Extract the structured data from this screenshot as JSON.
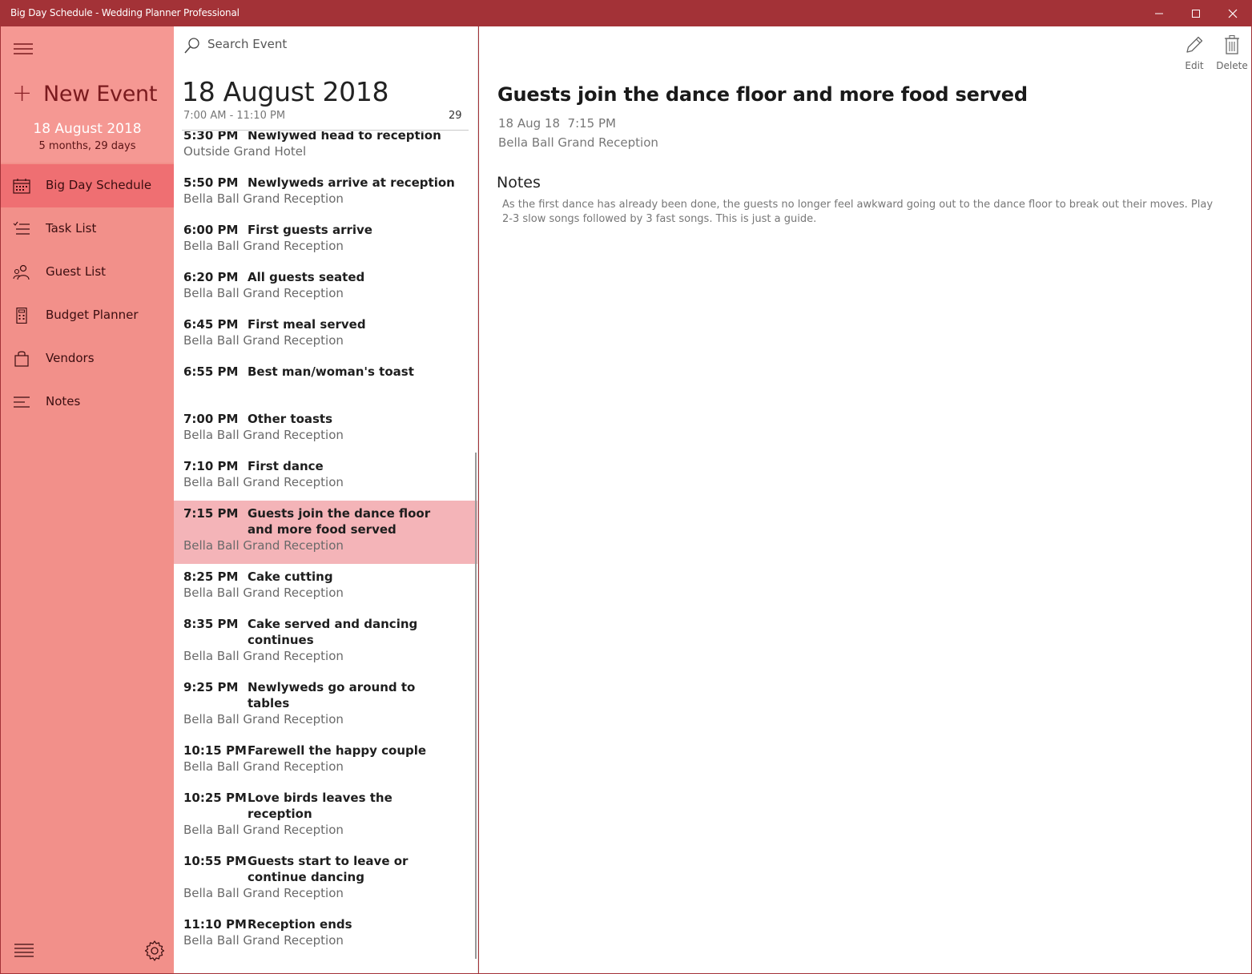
{
  "window": {
    "title": "Big Day Schedule - Wedding Planner Professional",
    "min_glyph": "—",
    "close_glyph": "✕"
  },
  "sidebar": {
    "new_event_label": "New Event",
    "plus_glyph": "+",
    "wedding_date": "18 August 2018",
    "countdown": "5 months, 29 days",
    "items": [
      {
        "label": "Big Day Schedule",
        "icon": "calendar-icon",
        "active": true
      },
      {
        "label": "Task List",
        "icon": "checklist-icon",
        "active": false
      },
      {
        "label": "Guest List",
        "icon": "people-icon",
        "active": false
      },
      {
        "label": "Budget Planner",
        "icon": "calculator-icon",
        "active": false
      },
      {
        "label": "Vendors",
        "icon": "shopping-bag-icon",
        "active": false
      },
      {
        "label": "Notes",
        "icon": "notes-icon",
        "active": false
      }
    ]
  },
  "list": {
    "search_placeholder": "Search Event",
    "date": "18 August 2018",
    "time_range": "7:00 AM - 11:10 PM",
    "event_count": "29",
    "events": [
      {
        "time": "5:30 PM",
        "name": "Newlywed head to reception",
        "location": "Outside Grand Hotel",
        "selected": false
      },
      {
        "time": "5:50 PM",
        "name": "Newlyweds arrive at reception",
        "location": "Bella Ball Grand Reception",
        "selected": false
      },
      {
        "time": "6:00 PM",
        "name": "First guests arrive",
        "location": "Bella Ball Grand Reception",
        "selected": false
      },
      {
        "time": "6:20 PM",
        "name": "All guests seated",
        "location": "Bella Ball Grand Reception",
        "selected": false
      },
      {
        "time": "6:45 PM",
        "name": "First meal served",
        "location": "Bella Ball Grand Reception",
        "selected": false
      },
      {
        "time": "6:55 PM",
        "name": "Best man/woman's toast",
        "location": "",
        "selected": false
      },
      {
        "time": "7:00 PM",
        "name": "Other toasts",
        "location": "Bella Ball Grand Reception",
        "selected": false
      },
      {
        "time": "7:10 PM",
        "name": "First dance",
        "location": "Bella Ball Grand Reception",
        "selected": false
      },
      {
        "time": "7:15 PM",
        "name": "Guests join the dance floor and more food served",
        "location": "Bella Ball Grand Reception",
        "selected": true
      },
      {
        "time": "8:25 PM",
        "name": "Cake cutting",
        "location": "Bella Ball Grand Reception",
        "selected": false
      },
      {
        "time": "8:35 PM",
        "name": "Cake served and dancing continues",
        "location": "Bella Ball Grand Reception",
        "selected": false
      },
      {
        "time": "9:25 PM",
        "name": "Newlyweds go around to tables",
        "location": "Bella Ball Grand Reception",
        "selected": false
      },
      {
        "time": "10:15 PM",
        "name": "Farewell the happy couple",
        "location": "Bella Ball Grand Reception",
        "selected": false
      },
      {
        "time": "10:25 PM",
        "name": "Love birds leaves the reception",
        "location": "Bella Ball Grand Reception",
        "selected": false
      },
      {
        "time": "10:55 PM",
        "name": "Guests start to leave or continue dancing",
        "location": "Bella Ball Grand Reception",
        "selected": false
      },
      {
        "time": "11:10 PM",
        "name": "Reception ends",
        "location": "Bella Ball Grand Reception",
        "selected": false
      }
    ]
  },
  "detail": {
    "edit_label": "Edit",
    "delete_label": "Delete",
    "title": "Guests join the dance floor and more food served",
    "when": "18 Aug 18  7:15 PM",
    "location": "Bella Ball Grand Reception",
    "notes_heading": "Notes",
    "notes": "As the first dance has already been done, the guests no longer feel awkward going out to the dance floor to break out their moves. Play 2-3 slow songs followed by 3 fast songs. This is just a guide."
  },
  "colors": {
    "titlebar": "#a33237",
    "sidebar": "#f2908a",
    "sidebar_active": "#ef6f72",
    "selected_row": "#f4b4b8"
  }
}
